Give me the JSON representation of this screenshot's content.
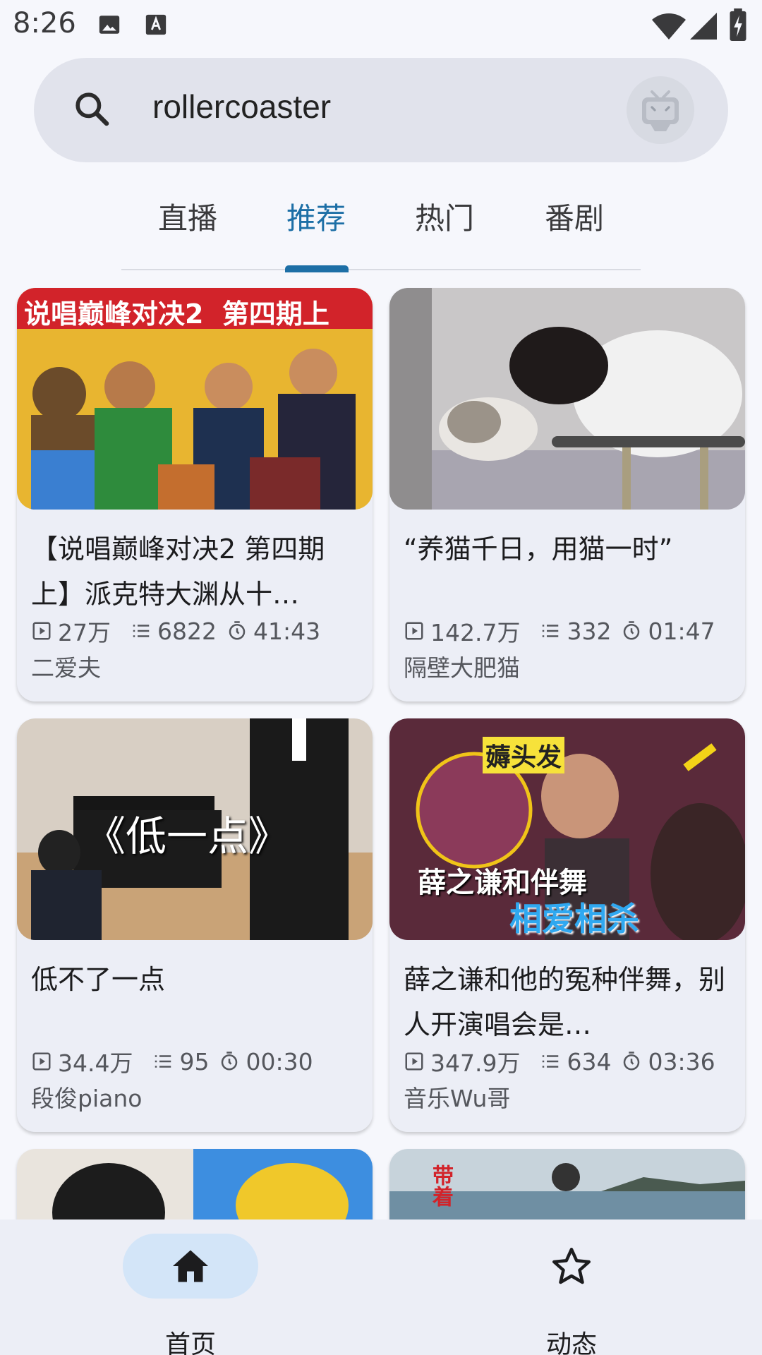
{
  "status_bar": {
    "time": "8:26"
  },
  "search": {
    "query": "rollercoaster"
  },
  "tabs": [
    {
      "label": "直播"
    },
    {
      "label": "推荐"
    },
    {
      "label": "热门"
    },
    {
      "label": "番剧"
    }
  ],
  "cards": [
    {
      "title": "【说唱巅峰对决2 第四期上】派克特大渊从十…",
      "views": "27万",
      "danmaku": "6822",
      "duration": "41:43",
      "author": "二爱夫",
      "thumb_text": "说唱巅峰对决2  第四期上"
    },
    {
      "title": "“养猫千日，用猫一时”",
      "views": "142.7万",
      "danmaku": "332",
      "duration": "01:47",
      "author": "隔壁大肥猫"
    },
    {
      "title": "低不了一点",
      "views": "34.4万",
      "danmaku": "95",
      "duration": "00:30",
      "author": "段俊piano",
      "thumb_text": "《低一点》"
    },
    {
      "title": "薛之谦和他的冤种伴舞，别人开演唱会是…",
      "views": "347.9万",
      "danmaku": "634",
      "duration": "03:36",
      "author": "音乐Wu哥",
      "thumb_text": "薅头发",
      "thumb_text2": "薛之谦和伴舞",
      "thumb_text3": "相爱相杀"
    },
    {
      "thumb_text": ""
    },
    {
      "thumb_text": "带着"
    }
  ],
  "bottom_nav": [
    {
      "label": "首页",
      "icon": "home-icon"
    },
    {
      "label": "动态",
      "icon": "star-icon"
    }
  ],
  "colors": {
    "accent": "#1d6fa6",
    "nav_pill": "#d3e5f8",
    "card_bg": "#eceef6"
  }
}
